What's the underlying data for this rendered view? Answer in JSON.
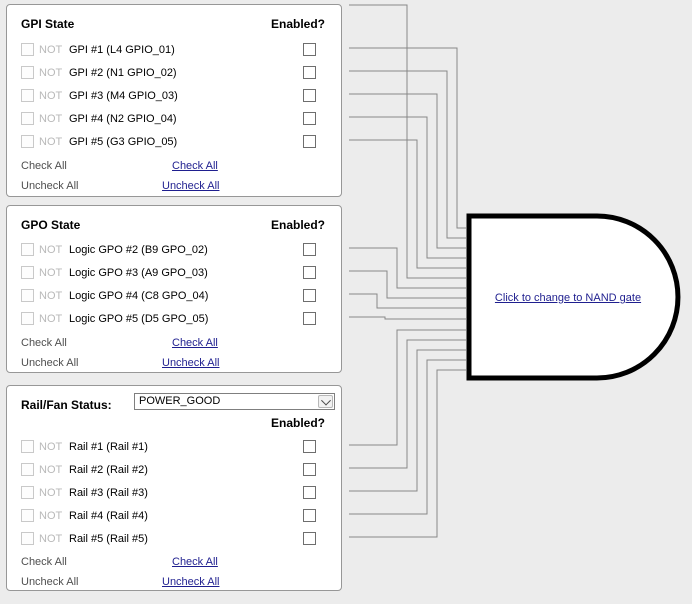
{
  "colors": {
    "background": "#ececec",
    "panel_border": "#979797",
    "wire": "#878787",
    "gate_border": "#000000",
    "link": "#1f1f8f",
    "disabled_text": "#b9b9b9"
  },
  "gpi_panel": {
    "title": "GPI State",
    "enabled_header": "Enabled?",
    "not_label": "NOT",
    "rows": [
      {
        "label": "GPI #1 (L4 GPIO_01)",
        "not_checked": false,
        "enabled_checked": false
      },
      {
        "label": "GPI #2 (N1 GPIO_02)",
        "not_checked": false,
        "enabled_checked": false
      },
      {
        "label": "GPI #3 (M4 GPIO_03)",
        "not_checked": false,
        "enabled_checked": false
      },
      {
        "label": "GPI #4 (N2 GPIO_04)",
        "not_checked": false,
        "enabled_checked": false
      },
      {
        "label": "GPI #5 (G3 GPIO_05)",
        "not_checked": false,
        "enabled_checked": false
      }
    ],
    "not_check_all": "Check All",
    "not_uncheck_all": "Uncheck All",
    "enabled_check_all": "Check All",
    "enabled_uncheck_all": "Uncheck All"
  },
  "gpo_panel": {
    "title": "GPO State",
    "enabled_header": "Enabled?",
    "not_label": "NOT",
    "rows": [
      {
        "label": "Logic GPO #2 (B9 GPO_02)",
        "not_checked": false,
        "enabled_checked": false
      },
      {
        "label": "Logic GPO #3 (A9 GPO_03)",
        "not_checked": false,
        "enabled_checked": false
      },
      {
        "label": "Logic GPO #4 (C8 GPO_04)",
        "not_checked": false,
        "enabled_checked": false
      },
      {
        "label": "Logic GPO #5 (D5 GPO_05)",
        "not_checked": false,
        "enabled_checked": false
      }
    ],
    "not_check_all": "Check All",
    "not_uncheck_all": "Uncheck All",
    "enabled_check_all": "Check All",
    "enabled_uncheck_all": "Uncheck All"
  },
  "rail_panel": {
    "title": "Rail/Fan Status:",
    "dropdown_value": "POWER_GOOD",
    "enabled_header": "Enabled?",
    "not_label": "NOT",
    "rows": [
      {
        "label": "Rail #1 (Rail #1)",
        "not_checked": false,
        "enabled_checked": false
      },
      {
        "label": "Rail #2 (Rail #2)",
        "not_checked": false,
        "enabled_checked": false
      },
      {
        "label": "Rail #3 (Rail #3)",
        "not_checked": false,
        "enabled_checked": false
      },
      {
        "label": "Rail #4 (Rail #4)",
        "not_checked": false,
        "enabled_checked": false
      },
      {
        "label": "Rail #5 (Rail #5)",
        "not_checked": false,
        "enabled_checked": false
      }
    ],
    "not_check_all": "Check All",
    "not_uncheck_all": "Uncheck All",
    "enabled_check_all": "Check All",
    "enabled_uncheck_all": "Uncheck All"
  },
  "gate": {
    "link_label": "Click to change to NAND gate"
  }
}
